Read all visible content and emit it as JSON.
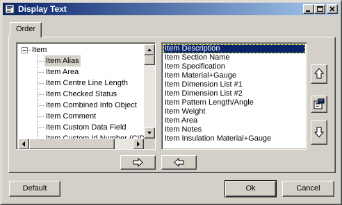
{
  "window": {
    "title": "Display Text"
  },
  "tabs": [
    {
      "label": "Order",
      "active": true
    }
  ],
  "tree": {
    "root_label": "Item",
    "children": [
      {
        "label": "Item Alias",
        "selected": true
      },
      {
        "label": "Item Area"
      },
      {
        "label": "Item Centre Line Length"
      },
      {
        "label": "Item Checked Status"
      },
      {
        "label": "Item Combined Info Object"
      },
      {
        "label": "Item Comment"
      },
      {
        "label": "Item Custom Data Field"
      },
      {
        "label": "Item Custom Id Number (CID)"
      }
    ]
  },
  "order_list": {
    "items": [
      {
        "label": "Item Description",
        "selected": true
      },
      {
        "label": "Item Section Name"
      },
      {
        "label": "Item Specification"
      },
      {
        "label": "Item Material+Gauge"
      },
      {
        "label": "Item Dimension List #1"
      },
      {
        "label": "Item Dimension List #2"
      },
      {
        "label": "Item Pattern Length/Angle"
      },
      {
        "label": "Item Weight"
      },
      {
        "label": "Item Area"
      },
      {
        "label": "Item Notes"
      },
      {
        "label": "Item Insulation Material+Gauge"
      }
    ]
  },
  "icons": {
    "add": "arrow-right-icon",
    "remove": "arrow-left-icon",
    "move_up": "arrow-up-icon",
    "properties": "properties-icon",
    "move_down": "arrow-down-icon"
  },
  "buttons": {
    "default_label": "Default",
    "ok_label": "Ok",
    "cancel_label": "Cancel"
  },
  "colors": {
    "titlebar_start": "#0a246a",
    "titlebar_end": "#a6caf0",
    "selection": "#0a246a",
    "face": "#d4d0c8"
  }
}
